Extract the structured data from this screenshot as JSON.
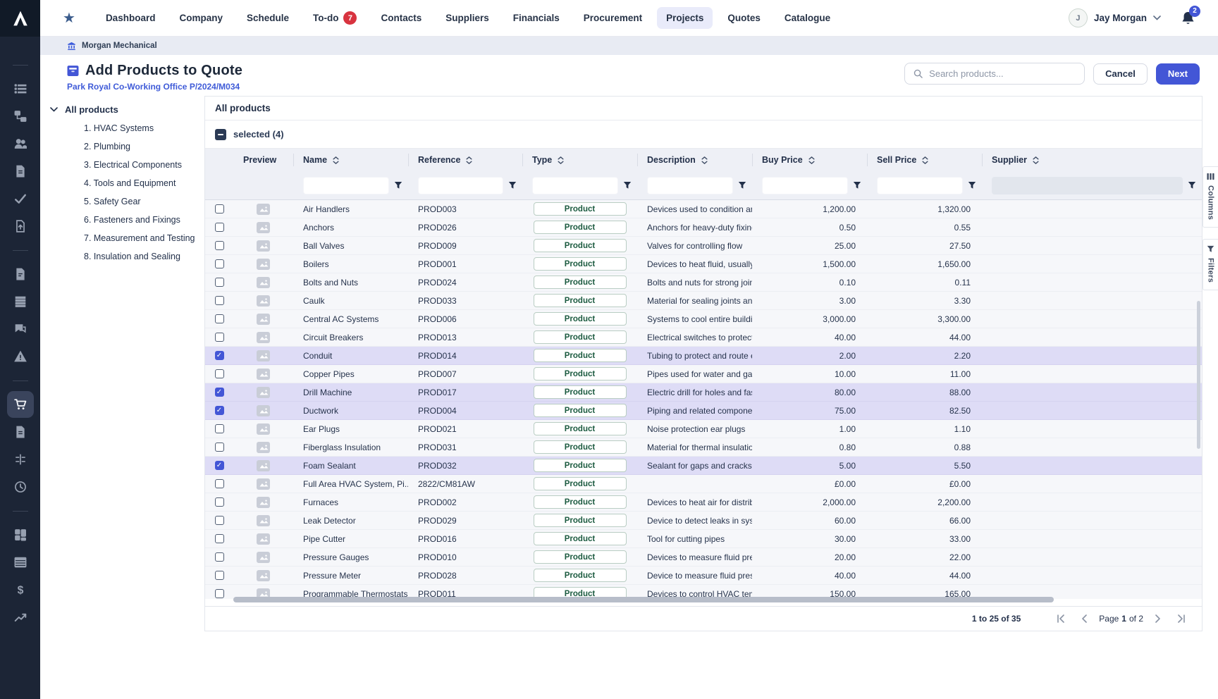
{
  "topnav": {
    "items": [
      {
        "label": "Dashboard"
      },
      {
        "label": "Company"
      },
      {
        "label": "Schedule"
      },
      {
        "label": "To-do",
        "badge": "7"
      },
      {
        "label": "Contacts"
      },
      {
        "label": "Suppliers"
      },
      {
        "label": "Financials"
      },
      {
        "label": "Procurement"
      },
      {
        "label": "Projects",
        "active": true
      },
      {
        "label": "Quotes"
      },
      {
        "label": "Catalogue"
      }
    ],
    "user": {
      "initial": "J",
      "name": "Jay Morgan"
    },
    "notifications": "2"
  },
  "breadcrumb": {
    "label": "Morgan Mechanical"
  },
  "page": {
    "title": "Add Products to Quote",
    "subtitle": "Park Royal Co-Working Office P/2024/M034",
    "search_placeholder": "Search products...",
    "cancel_label": "Cancel",
    "next_label": "Next"
  },
  "sidebar": {
    "icons": [
      "divider",
      "list",
      "org-chart",
      "users",
      "document",
      "check",
      "file-upload",
      "divider",
      "file",
      "rows",
      "chat",
      "warning",
      "divider",
      "cart",
      "document",
      "sliders",
      "clock",
      "divider",
      "grid",
      "table",
      "dollar",
      "trend"
    ],
    "active_icon": "cart"
  },
  "tree": {
    "root": "All products",
    "items": [
      "1. HVAC Systems",
      "2. Plumbing",
      "3. Electrical Components",
      "4. Tools and Equipment",
      "5. Safety Gear",
      "6. Fasteners and Fixings",
      "7. Measurement and Testing",
      "8. Insulation and Sealing"
    ]
  },
  "table": {
    "section_title": "All products",
    "selected_label": "selected (4)",
    "columns": [
      {
        "label": "",
        "sortable": false,
        "filter": "none"
      },
      {
        "label": "Preview",
        "sortable": false,
        "filter": "none"
      },
      {
        "label": "Name",
        "sortable": true,
        "filter": "input"
      },
      {
        "label": "Reference",
        "sortable": true,
        "filter": "input"
      },
      {
        "label": "Type",
        "sortable": true,
        "filter": "input"
      },
      {
        "label": "Description",
        "sortable": true,
        "filter": "input"
      },
      {
        "label": "Buy Price",
        "sortable": true,
        "filter": "input"
      },
      {
        "label": "Sell Price",
        "sortable": true,
        "filter": "input"
      },
      {
        "label": "Supplier",
        "sortable": true,
        "filter": "input-disabled"
      }
    ],
    "rows": [
      {
        "name": "Air Handlers",
        "reference": "PROD003",
        "type": "Product",
        "description": "Devices used to condition and c",
        "buy": "1,200.00",
        "sell": "1,320.00",
        "supplier": "",
        "selected": false
      },
      {
        "name": "Anchors",
        "reference": "PROD026",
        "type": "Product",
        "description": "Anchors for heavy-duty fixings",
        "buy": "0.50",
        "sell": "0.55",
        "supplier": "",
        "selected": false
      },
      {
        "name": "Ball Valves",
        "reference": "PROD009",
        "type": "Product",
        "description": "Valves for controlling flow",
        "buy": "25.00",
        "sell": "27.50",
        "supplier": "",
        "selected": false
      },
      {
        "name": "Boilers",
        "reference": "PROD001",
        "type": "Product",
        "description": "Devices to heat fluid, usually wa",
        "buy": "1,500.00",
        "sell": "1,650.00",
        "supplier": "",
        "selected": false
      },
      {
        "name": "Bolts and Nuts",
        "reference": "PROD024",
        "type": "Product",
        "description": "Bolts and nuts for strong joints",
        "buy": "0.10",
        "sell": "0.11",
        "supplier": "",
        "selected": false
      },
      {
        "name": "Caulk",
        "reference": "PROD033",
        "type": "Product",
        "description": "Material for sealing joints and se",
        "buy": "3.00",
        "sell": "3.30",
        "supplier": "",
        "selected": false
      },
      {
        "name": "Central AC Systems",
        "reference": "PROD006",
        "type": "Product",
        "description": "Systems to cool entire buildings",
        "buy": "3,000.00",
        "sell": "3,300.00",
        "supplier": "",
        "selected": false
      },
      {
        "name": "Circuit Breakers",
        "reference": "PROD013",
        "type": "Product",
        "description": "Electrical switches to protect cir",
        "buy": "40.00",
        "sell": "44.00",
        "supplier": "",
        "selected": false
      },
      {
        "name": "Conduit",
        "reference": "PROD014",
        "type": "Product",
        "description": "Tubing to protect and route elec",
        "buy": "2.00",
        "sell": "2.20",
        "supplier": "",
        "selected": true
      },
      {
        "name": "Copper Pipes",
        "reference": "PROD007",
        "type": "Product",
        "description": "Pipes used for water and gas di",
        "buy": "10.00",
        "sell": "11.00",
        "supplier": "",
        "selected": false
      },
      {
        "name": "Drill Machine",
        "reference": "PROD017",
        "type": "Product",
        "description": "Electric drill for holes and faster",
        "buy": "80.00",
        "sell": "88.00",
        "supplier": "",
        "selected": true
      },
      {
        "name": "Ductwork",
        "reference": "PROD004",
        "type": "Product",
        "description": "Piping and related components",
        "buy": "75.00",
        "sell": "82.50",
        "supplier": "",
        "selected": true
      },
      {
        "name": "Ear Plugs",
        "reference": "PROD021",
        "type": "Product",
        "description": "Noise protection ear plugs",
        "buy": "1.00",
        "sell": "1.10",
        "supplier": "",
        "selected": false
      },
      {
        "name": "Fiberglass Insulation",
        "reference": "PROD031",
        "type": "Product",
        "description": "Material for thermal insulation",
        "buy": "0.80",
        "sell": "0.88",
        "supplier": "",
        "selected": false
      },
      {
        "name": "Foam Sealant",
        "reference": "PROD032",
        "type": "Product",
        "description": "Sealant for gaps and cracks",
        "buy": "5.00",
        "sell": "5.50",
        "supplier": "",
        "selected": true
      },
      {
        "name": "Full Area HVAC System, Pi...",
        "reference": "2822/CM81AW",
        "type": "Product",
        "description": "",
        "buy": "£0.00",
        "sell": "£0.00",
        "supplier": "",
        "selected": false
      },
      {
        "name": "Furnaces",
        "reference": "PROD002",
        "type": "Product",
        "description": "Devices to heat air for distributi",
        "buy": "2,000.00",
        "sell": "2,200.00",
        "supplier": "",
        "selected": false
      },
      {
        "name": "Leak Detector",
        "reference": "PROD029",
        "type": "Product",
        "description": "Device to detect leaks in system",
        "buy": "60.00",
        "sell": "66.00",
        "supplier": "",
        "selected": false
      },
      {
        "name": "Pipe Cutter",
        "reference": "PROD016",
        "type": "Product",
        "description": "Tool for cutting pipes",
        "buy": "30.00",
        "sell": "33.00",
        "supplier": "",
        "selected": false
      },
      {
        "name": "Pressure Gauges",
        "reference": "PROD010",
        "type": "Product",
        "description": "Devices to measure fluid pressu",
        "buy": "20.00",
        "sell": "22.00",
        "supplier": "",
        "selected": false
      },
      {
        "name": "Pressure Meter",
        "reference": "PROD028",
        "type": "Product",
        "description": "Device to measure fluid pressur",
        "buy": "40.00",
        "sell": "44.00",
        "supplier": "",
        "selected": false
      },
      {
        "name": "Programmable Thermostats",
        "reference": "PROD011",
        "type": "Product",
        "description": "Devices to control HVAC temper",
        "buy": "150.00",
        "sell": "165.00",
        "supplier": "",
        "selected": false
      }
    ],
    "pagination": {
      "range": "1 to 25 of 35",
      "page_prefix": "Page",
      "page_current": "1",
      "page_suffix": "of 2"
    }
  },
  "side_tabs": {
    "columns": "Columns",
    "filters": "Filters"
  },
  "colors": {
    "accent": "#4356d6",
    "selected_row": "#dedcf6",
    "badge_text": "#1c5b40",
    "todo_badge": "#d8333f",
    "sidebar_bg": "#1c2536"
  }
}
